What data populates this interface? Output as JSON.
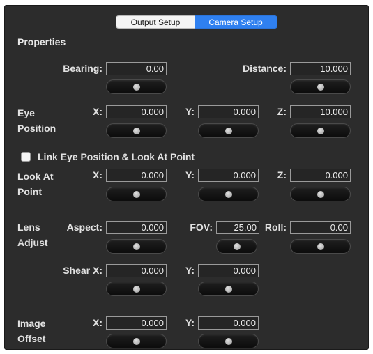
{
  "tabs": [
    {
      "label": "Output Setup",
      "selected": false
    },
    {
      "label": "Camera Setup",
      "selected": true
    }
  ],
  "colors": {
    "accent": "#2f80f0",
    "panel_bg": "#2c2c2c"
  },
  "properties_heading": "Properties",
  "bearing": {
    "label": "Bearing:",
    "value": "0.00"
  },
  "distance": {
    "label": "Distance:",
    "value": "10.000"
  },
  "eye_position": {
    "group_label_line1": "Eye",
    "group_label_line2": "Position",
    "x": {
      "label": "X:",
      "value": "0.000"
    },
    "y": {
      "label": "Y:",
      "value": "0.000"
    },
    "z": {
      "label": "Z:",
      "value": "10.000"
    }
  },
  "link_checkbox": {
    "label": "Link Eye Position & Look At Point",
    "checked": false
  },
  "look_at_point": {
    "group_label_line1": "Look At",
    "group_label_line2": "Point",
    "x": {
      "label": "X:",
      "value": "0.000"
    },
    "y": {
      "label": "Y:",
      "value": "0.000"
    },
    "z": {
      "label": "Z:",
      "value": "0.000"
    }
  },
  "lens_adjust": {
    "group_label_line1": "Lens",
    "group_label_line2": "Adjust",
    "aspect": {
      "label": "Aspect:",
      "value": "0.000"
    },
    "fov": {
      "label": "FOV:",
      "value": "25.00"
    },
    "roll": {
      "label": "Roll:",
      "value": "0.00"
    },
    "shear_x": {
      "label": "Shear X:",
      "value": "0.000"
    },
    "shear_y": {
      "label": "Y:",
      "value": "0.000"
    }
  },
  "image_offset": {
    "group_label_line1": "Image",
    "group_label_line2": "Offset",
    "x": {
      "label": "X:",
      "value": "0.000"
    },
    "y": {
      "label": "Y:",
      "value": "0.000"
    }
  }
}
